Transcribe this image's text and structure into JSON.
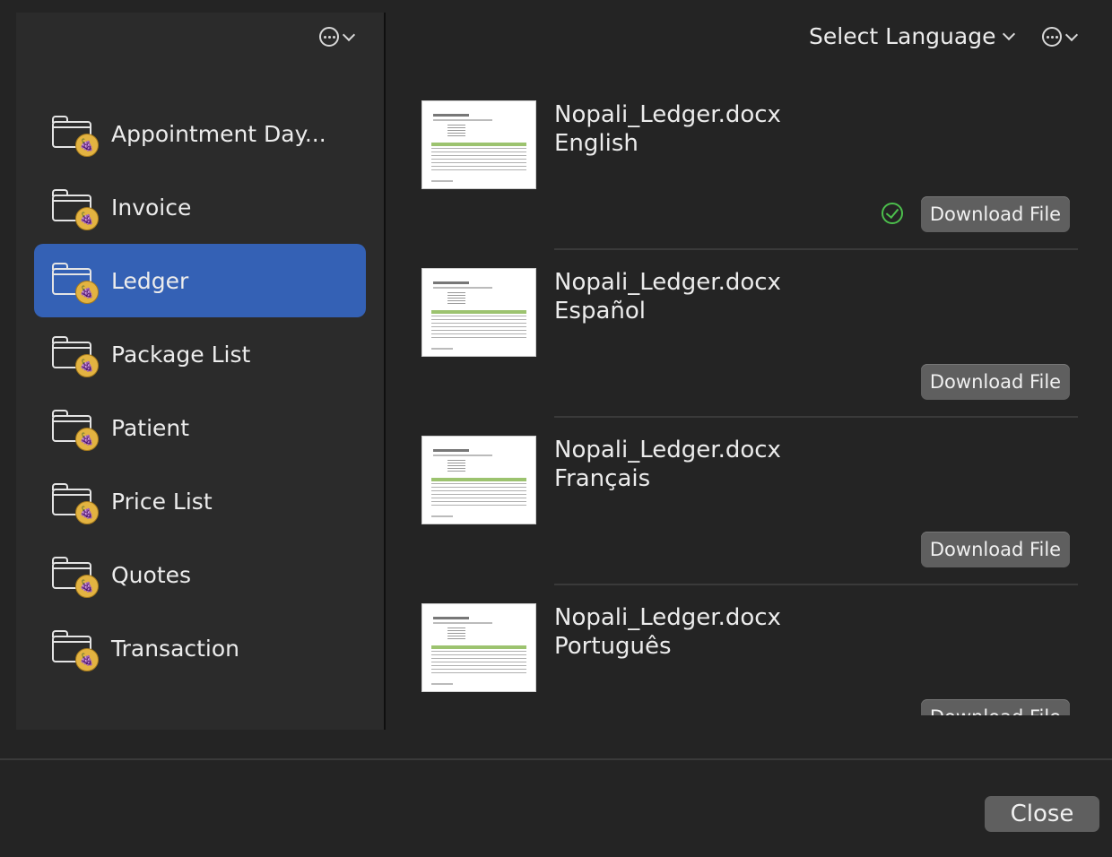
{
  "sidebar": {
    "more_icon": "ellipsis-circle-icon",
    "items": [
      {
        "label": "Appointment Day...",
        "selected": false
      },
      {
        "label": "Invoice",
        "selected": false
      },
      {
        "label": "Ledger",
        "selected": true
      },
      {
        "label": "Package List",
        "selected": false
      },
      {
        "label": "Patient",
        "selected": false
      },
      {
        "label": "Price List",
        "selected": false
      },
      {
        "label": "Quotes",
        "selected": false
      },
      {
        "label": "Transaction",
        "selected": false
      }
    ]
  },
  "header": {
    "language_select_label": "Select Language"
  },
  "files": [
    {
      "name": "Nopali_Ledger.docx",
      "language": "English",
      "button": "Download File",
      "downloaded": true
    },
    {
      "name": "Nopali_Ledger.docx",
      "language": "Español",
      "button": "Download File",
      "downloaded": false
    },
    {
      "name": "Nopali_Ledger.docx",
      "language": "Français",
      "button": "Download File",
      "downloaded": false
    },
    {
      "name": "Nopali_Ledger.docx",
      "language": "Português",
      "button": "Download File",
      "downloaded": false
    }
  ],
  "footer": {
    "close_label": "Close"
  },
  "colors": {
    "accent_selected": "#3461b5",
    "success": "#4cbf4c",
    "background": "#242424"
  }
}
